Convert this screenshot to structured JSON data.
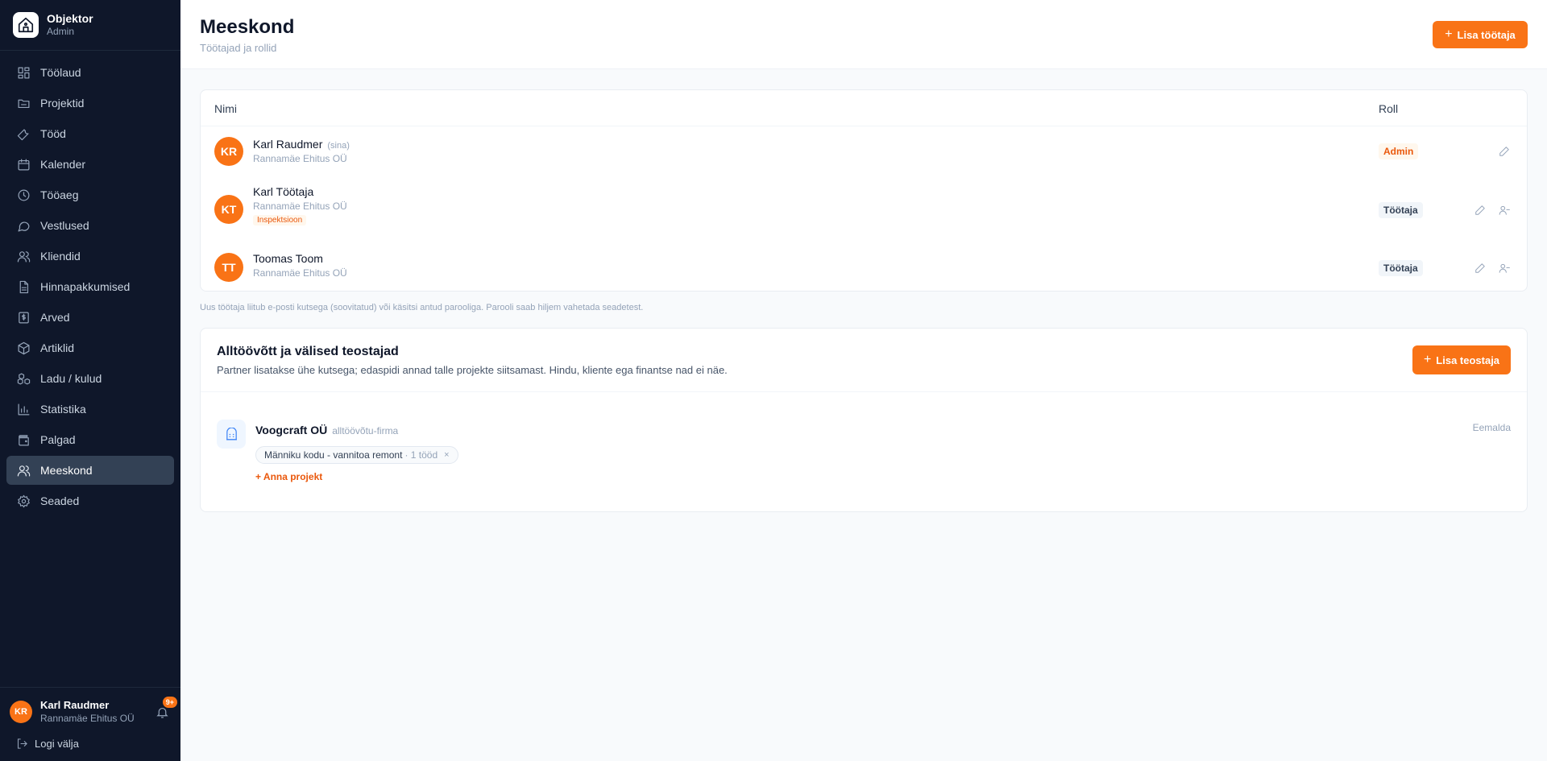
{
  "brand": {
    "name": "Objektor",
    "role": "Admin"
  },
  "nav": [
    {
      "label": "Töölaud",
      "icon": "dashboard-icon"
    },
    {
      "label": "Projektid",
      "icon": "folder-icon"
    },
    {
      "label": "Tööd",
      "icon": "wrench-icon"
    },
    {
      "label": "Kalender",
      "icon": "calendar-icon"
    },
    {
      "label": "Tööaeg",
      "icon": "clock-icon"
    },
    {
      "label": "Vestlused",
      "icon": "chat-icon"
    },
    {
      "label": "Kliendid",
      "icon": "users-icon"
    },
    {
      "label": "Hinnapakkumised",
      "icon": "document-icon"
    },
    {
      "label": "Arved",
      "icon": "invoice-icon"
    },
    {
      "label": "Artiklid",
      "icon": "box-icon"
    },
    {
      "label": "Ladu / kulud",
      "icon": "boxes-icon"
    },
    {
      "label": "Statistika",
      "icon": "bar-chart-icon"
    },
    {
      "label": "Palgad",
      "icon": "wallet-icon"
    },
    {
      "label": "Meeskond",
      "icon": "team-icon",
      "active": true
    },
    {
      "label": "Seaded",
      "icon": "gear-icon"
    }
  ],
  "footer": {
    "initials": "KR",
    "name": "Karl Raudmer",
    "company": "Rannamäe Ehitus OÜ",
    "notifications": "9+",
    "logout": "Logi välja"
  },
  "header": {
    "title": "Meeskond",
    "subtitle": "Töötajad ja rollid",
    "add_button": "Lisa töötaja"
  },
  "team": {
    "col_name": "Nimi",
    "col_role": "Roll",
    "members": [
      {
        "initials": "KR",
        "name": "Karl Raudmer",
        "you": "(sina)",
        "company": "Rannamäe Ehitus OÜ",
        "tag": "",
        "role": "Admin"
      },
      {
        "initials": "KT",
        "name": "Karl Töötaja",
        "you": "",
        "company": "Rannamäe Ehitus OÜ",
        "tag": "Inspektsioon",
        "role": "Töötaja"
      },
      {
        "initials": "TT",
        "name": "Toomas Toom",
        "you": "",
        "company": "Rannamäe Ehitus OÜ",
        "tag": "",
        "role": "Töötaja"
      }
    ]
  },
  "note": "Uus töötaja liitub e-posti kutsega (soovitatud) või käsitsi antud parooliga. Parooli saab hiljem vahetada seadetest.",
  "partners": {
    "title": "Alltöövõtt ja välised teostajad",
    "description": "Partner lisatakse ühe kutsega; edaspidi annad talle projekte siitsamast. Hindu, kliente ega finantse nad ei näe.",
    "add_button": "Lisa teostaja",
    "firm": {
      "name": "Voogcraft OÜ",
      "type": "alltöövõtu-firma",
      "remove": "Eemalda",
      "project": "Männiku kodu - vannitoa remont",
      "project_count": "· 1 tööd",
      "remove_project": "×",
      "assign": "+ Anna projekt"
    }
  },
  "colors": {
    "accent": "#f97316",
    "sidebar": "#0f172a"
  }
}
